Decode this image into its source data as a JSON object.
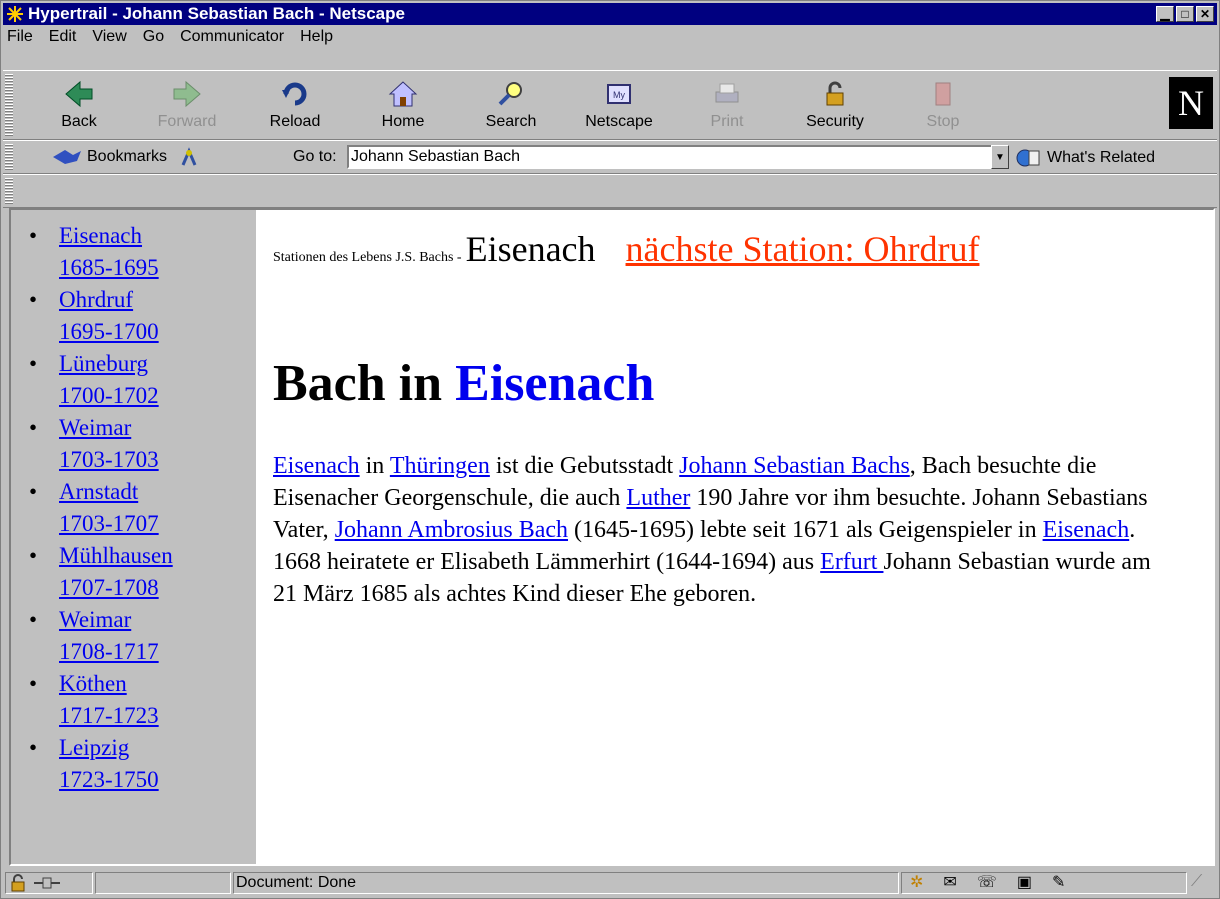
{
  "window": {
    "title": "Hypertrail - Johann Sebastian Bach - Netscape"
  },
  "menu": [
    "File",
    "Edit",
    "View",
    "Go",
    "Communicator",
    "Help"
  ],
  "nav_buttons": [
    {
      "label": "Back",
      "icon": "back-arrow-icon",
      "enabled": true
    },
    {
      "label": "Forward",
      "icon": "forward-arrow-icon",
      "enabled": false
    },
    {
      "label": "Reload",
      "icon": "reload-icon",
      "enabled": true
    },
    {
      "label": "Home",
      "icon": "home-icon",
      "enabled": true
    },
    {
      "label": "Search",
      "icon": "search-icon",
      "enabled": true
    },
    {
      "label": "Netscape",
      "icon": "my-netscape-icon",
      "enabled": true
    },
    {
      "label": "Print",
      "icon": "print-icon",
      "enabled": false
    },
    {
      "label": "Security",
      "icon": "lock-icon",
      "enabled": true
    },
    {
      "label": "Stop",
      "icon": "stop-icon",
      "enabled": false
    }
  ],
  "location": {
    "bookmarks_label": "Bookmarks",
    "goto_label": "Go to:",
    "url_value": "Johann Sebastian Bach",
    "related_label": "What's Related"
  },
  "sidebar": {
    "items": [
      {
        "place": "Eisenach",
        "years": "1685-1695"
      },
      {
        "place": "Ohrdruf",
        "years": "1695-1700"
      },
      {
        "place": "Lüneburg",
        "years": "1700-1702"
      },
      {
        "place": "Weimar",
        "years": "1703-1703"
      },
      {
        "place": "Arnstadt",
        "years": "1703-1707"
      },
      {
        "place": "Mühlhausen",
        "years": "1707-1708"
      },
      {
        "place": "Weimar",
        "years": "1708-1717"
      },
      {
        "place": "Köthen",
        "years": "1717-1723"
      },
      {
        "place": "Leipzig",
        "years": "1723-1750"
      }
    ]
  },
  "main": {
    "stations_prefix": "Stationen des Lebens J.S. Bachs -",
    "current_station": "Eisenach",
    "next_station": "nächste Station: Ohrdruf",
    "heading_prefix": "Bach in",
    "heading_link": "Eisenach",
    "paragraph": {
      "l_eisenach1": "Eisenach",
      "t1": " in ",
      "l_thueringen": "Thüringen",
      "t2": " ist die Gebutsstadt ",
      "l_jsb": "Johann Sebastian Bachs",
      "t3": ", Bach besuchte die Eisenacher Georgenschule, die auch ",
      "l_luther": "Luther",
      "t4": " 190 Jahre vor ihm besuchte. Johann Sebastians Vater, ",
      "l_jab": "Johann Ambrosius Bach",
      "t5": " (1645-1695) lebte seit 1671 als Geigenspieler in ",
      "l_eisenach2": "Eisenach",
      "t6": ". 1668 heiratete er Elisabeth Lämmerhirt (1644-1694) aus ",
      "l_erfurt": "Erfurt ",
      "t7": "Johann Sebastian wurde am 21 März 1685 als achtes Kind dieser Ehe geboren."
    }
  },
  "status": {
    "text": "Document: Done"
  }
}
